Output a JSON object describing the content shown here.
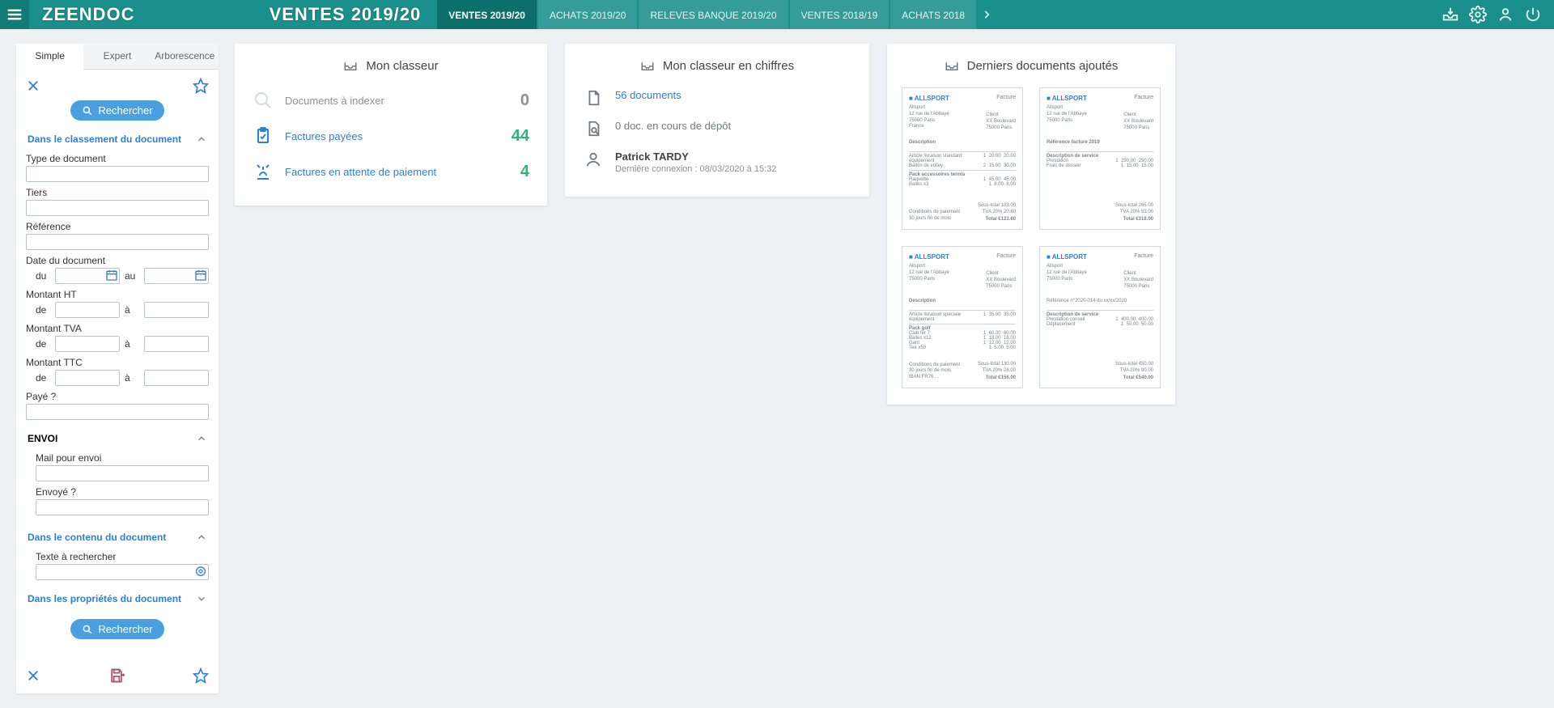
{
  "top": {
    "logo": "ZEENDOC",
    "page_title": "VENTES 2019/20",
    "tabs": [
      {
        "label": "VENTES 2019/20",
        "active": true
      },
      {
        "label": "ACHATS 2019/20",
        "active": false
      },
      {
        "label": "RELEVES BANQUE 2019/20",
        "active": false
      },
      {
        "label": "VENTES 2018/19",
        "active": false
      },
      {
        "label": "ACHATS 2018",
        "active": false
      }
    ]
  },
  "sidebar": {
    "tabs": {
      "simple": "Simple",
      "expert": "Expert",
      "arbo": "Arborescence"
    },
    "search_btn": "Rechercher",
    "sections": {
      "classement": "Dans le classement du document",
      "envoi": "ENVOI",
      "contenu": "Dans le contenu du document",
      "proprietes": "Dans les propriétés du document"
    },
    "fields": {
      "type_doc": "Type de document",
      "tiers": "Tiers",
      "reference": "Référence",
      "date_doc": "Date du document",
      "du": "du",
      "au": "au",
      "montant_ht": "Montant HT",
      "montant_tva": "Montant TVA",
      "montant_ttc": "Montant TTC",
      "de": "de",
      "a": "à",
      "paye": "Payé ?",
      "mail_envoi": "Mail pour envoi",
      "envoye": "Envoyé ?",
      "texte_rech": "Texte à rechercher"
    }
  },
  "panels": {
    "mon_classeur": {
      "title": "Mon classeur",
      "rows": [
        {
          "label": "Documents à indexer",
          "value": "0",
          "dim": true,
          "icon": "magnifier"
        },
        {
          "label": "Factures payées",
          "value": "44",
          "dim": false,
          "icon": "clipboard-check"
        },
        {
          "label": "Factures en attente de paiement",
          "value": "4",
          "dim": false,
          "icon": "alarm"
        }
      ]
    },
    "chiffres": {
      "title": "Mon classeur en chiffres",
      "doc_count": "56 documents",
      "depot": "0 doc. en cours de dépôt",
      "user_name": "Patrick TARDY",
      "last_login": "Dernière connexion : 08/03/2020 à 15:32"
    },
    "recent": {
      "title": "Derniers documents ajoutés"
    }
  }
}
